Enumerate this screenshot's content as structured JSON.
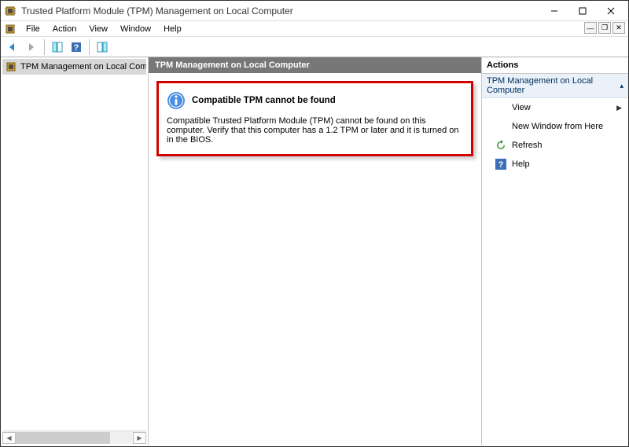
{
  "window": {
    "title": "Trusted Platform Module (TPM) Management on Local Computer"
  },
  "menu": {
    "file": "File",
    "action": "Action",
    "view": "View",
    "window": "Window",
    "help": "Help"
  },
  "tree": {
    "root": "TPM Management on Local Comp"
  },
  "center": {
    "header": "TPM Management on Local Computer",
    "info_title": "Compatible TPM cannot be found",
    "info_text": "Compatible Trusted Platform Module (TPM) cannot be found on this computer. Verify that this computer has a 1.2 TPM or later and it is turned on in the BIOS."
  },
  "actions": {
    "panel_title": "Actions",
    "group_title": "TPM Management on Local Computer",
    "items": {
      "view": "View",
      "new_window": "New Window from Here",
      "refresh": "Refresh",
      "help": "Help"
    }
  }
}
